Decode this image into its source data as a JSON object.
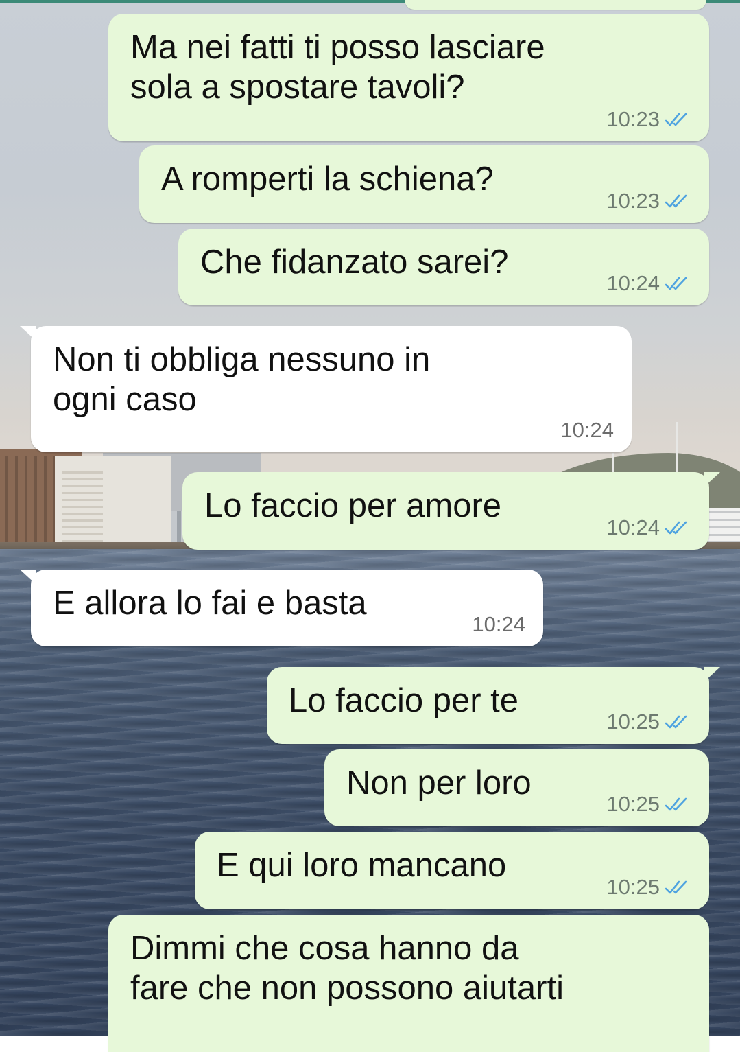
{
  "theme": {
    "outgoing_bubble_color": "#e7f8d9",
    "incoming_bubble_color": "#ffffff",
    "read_tick_color": "#4fa3e0",
    "header_strip_color": "#3c8a78"
  },
  "messages": [
    {
      "direction": "out",
      "text": "Ma nei fatti ti posso lasciare\nsola a spostare tavoli?",
      "time": "10:23",
      "status": "read"
    },
    {
      "direction": "out",
      "text": "A romperti la schiena?",
      "time": "10:23",
      "status": "read"
    },
    {
      "direction": "out",
      "text": "Che fidanzato sarei?",
      "time": "10:24",
      "status": "read"
    },
    {
      "direction": "in",
      "text": "Non ti obbliga nessuno in\nogni caso",
      "time": "10:24"
    },
    {
      "direction": "out",
      "text": "Lo faccio per amore",
      "time": "10:24",
      "status": "read"
    },
    {
      "direction": "in",
      "text": "E allora lo fai e basta",
      "time": "10:24"
    },
    {
      "direction": "out",
      "text": "Lo faccio per te",
      "time": "10:25",
      "status": "read"
    },
    {
      "direction": "out",
      "text": "Non per loro",
      "time": "10:25",
      "status": "read"
    },
    {
      "direction": "out",
      "text": "E qui loro mancano",
      "time": "10:25",
      "status": "read"
    },
    {
      "direction": "out",
      "text": "Dimmi che cosa hanno da\nfare che non possono aiutarti",
      "time": "",
      "status": ""
    }
  ]
}
